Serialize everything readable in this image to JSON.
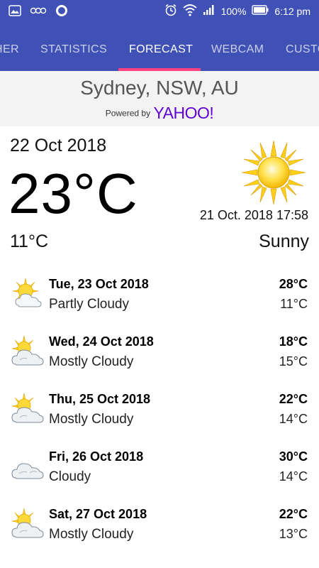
{
  "status_bar": {
    "battery": "100%",
    "time": "6:12 pm",
    "icons": [
      "image-icon",
      "voicemail-icon",
      "circle-icon",
      "alarm-icon",
      "wifi-icon",
      "signal-icon",
      "battery-icon"
    ]
  },
  "tabs": [
    {
      "label": "HER"
    },
    {
      "label": "STATISTICS"
    },
    {
      "label": "FORECAST",
      "active": true
    },
    {
      "label": "WEBCAM"
    },
    {
      "label": "CUSTO"
    }
  ],
  "location": {
    "city": "Sydney, NSW, AU",
    "powered_by": "Powered by",
    "brand": "YAHOO!"
  },
  "current": {
    "date": "22 Oct 2018",
    "temperature": "23°C",
    "updated": "21 Oct. 2018 17:58",
    "low": "11°C",
    "condition": "Sunny",
    "icon": "sun-icon"
  },
  "forecast": [
    {
      "date": "Tue, 23 Oct 2018",
      "condition": "Partly Cloudy",
      "high": "28°C",
      "low": "11°C",
      "icon": "partly-cloudy-icon"
    },
    {
      "date": "Wed, 24 Oct 2018",
      "condition": "Mostly Cloudy",
      "high": "18°C",
      "low": "15°C",
      "icon": "mostly-cloudy-icon"
    },
    {
      "date": "Thu, 25 Oct 2018",
      "condition": "Mostly Cloudy",
      "high": "22°C",
      "low": "14°C",
      "icon": "mostly-cloudy-icon"
    },
    {
      "date": "Fri, 26 Oct 2018",
      "condition": "Cloudy",
      "high": "30°C",
      "low": "14°C",
      "icon": "cloudy-icon"
    },
    {
      "date": "Sat, 27 Oct 2018",
      "condition": "Mostly Cloudy",
      "high": "22°C",
      "low": "13°C",
      "icon": "mostly-cloudy-icon"
    }
  ],
  "colors": {
    "primary": "#3f51b5",
    "tab_indicator": "#ff4081",
    "yahoo_purple": "#5f01d1",
    "sun_yellow": "#ffd400"
  }
}
